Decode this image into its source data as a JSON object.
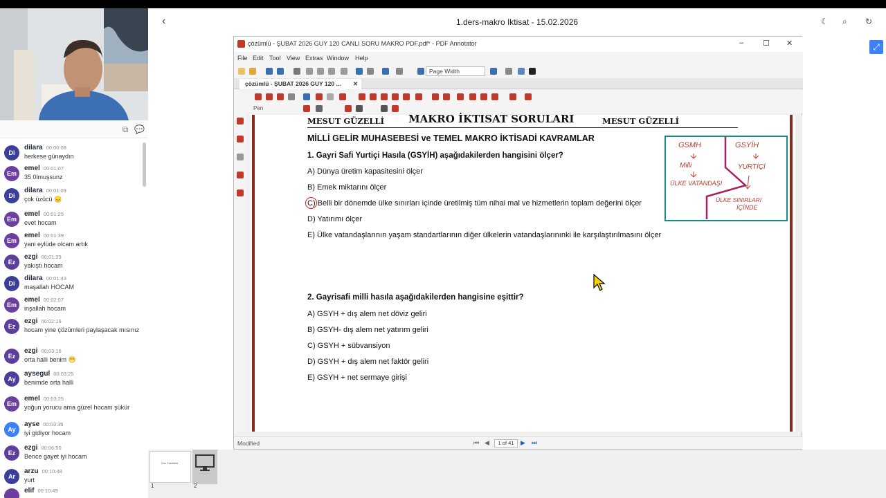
{
  "chat": {
    "messages": [
      {
        "initials": "Di",
        "name": "dilara",
        "time": "00:00:08",
        "text": "herkese günaydın",
        "color": "#3b3f9a"
      },
      {
        "initials": "Em",
        "name": "emel",
        "time": "00:01:07",
        "text": "35 0lmuşsunz",
        "color": "#6b3fa0"
      },
      {
        "initials": "Di",
        "name": "dilara",
        "time": "00:01:09",
        "text": "çok üzücü 😞",
        "color": "#3b3f9a"
      },
      {
        "initials": "Em",
        "name": "emel",
        "time": "00:01:25",
        "text": "evet hocam",
        "color": "#6b3fa0"
      },
      {
        "initials": "Em",
        "name": "emel",
        "time": "00:01:39",
        "text": "yani eylüde olcam artık",
        "color": "#6b3fa0"
      },
      {
        "initials": "Ez",
        "name": "ezgi",
        "time": "00:01:39",
        "text": "yakıştı hocam",
        "color": "#5b3f9a"
      },
      {
        "initials": "Di",
        "name": "dilara",
        "time": "00:01:43",
        "text": "maşallah HOCAM",
        "color": "#3b3f9a"
      },
      {
        "initials": "Em",
        "name": "emel",
        "time": "00:02:07",
        "text": "inşallah hocam",
        "color": "#6b3fa0"
      },
      {
        "initials": "Ez",
        "name": "ezgi",
        "time": "00:02:19",
        "text": "hocam yine çözümleri paylaşacak mısınız",
        "color": "#5b3f9a"
      },
      {
        "initials": "Ez",
        "name": "ezgi",
        "time": "00:03:16",
        "text": "orta halli benim 😁",
        "color": "#5b3f9a"
      },
      {
        "initials": "Ay",
        "name": "aysegul",
        "time": "00:03:25",
        "text": "benimde orta halli",
        "color": "#4a3f9a"
      },
      {
        "initials": "Em",
        "name": "emel",
        "time": "00:03:25",
        "text": "yoğun yorucu ama güzel hocam şükür",
        "color": "#6b3fa0"
      },
      {
        "initials": "Ay",
        "name": "ayse",
        "time": "00:03:36",
        "text": "iyi gidiyor hocam",
        "color": "#3b82f6"
      },
      {
        "initials": "Ez",
        "name": "ezgi",
        "time": "00:06:50",
        "text": "Bence gayet iyi hocam",
        "color": "#5b3f9a"
      },
      {
        "initials": "Ar",
        "name": "arzu",
        "time": "00:10:48",
        "text": "yurt",
        "color": "#3b3f9a"
      },
      {
        "initials": "",
        "name": "elif",
        "time": "00:10:49",
        "text": "",
        "color": "#6b3fa0"
      }
    ]
  },
  "header": {
    "title": "1.ders-makro Iktisat - 15.02.2026"
  },
  "app": {
    "window_title": "çözümlü - ŞUBAT 2026 GUY 120 CANLI SORU MAKRO PDF.pdf* - PDF Annotator",
    "menu": [
      "File",
      "Edit",
      "Tool",
      "View",
      "Extras",
      "Window",
      "Help"
    ],
    "zoom": "Page Width",
    "tab": "çözümlü - ŞUBAT 2026 GUY 120 ...",
    "pen_label": "Pen",
    "status": "Modified",
    "page_indicator": "1 of 41"
  },
  "doc": {
    "author_left": "MESUT GÜZELLİ",
    "heading": "MAKRO İKTISAT SORULARI",
    "author_right": "MESUT GÜZELLİ",
    "subheading": "MİLLİ GELİR MUHASEBESİ ve TEMEL MAKRO İKTİSADİ KAVRAMLAR",
    "q1": "1. Gayri Safi Yurtiçi Hasıla (GSYİH) aşağıdakilerden hangisini ölçer?",
    "q1_options": [
      "A)  Dünya üretim kapasitesini ölçer",
      "B)  Emek miktarını ölçer",
      "C)  Belli bir dönemde ülke sınırları içinde üretilmiş tüm nihai mal ve hizmetlerin toplam değerini ölçer",
      "D)  Yatırımı ölçer",
      "E)  Ülke vatandaşlarının yaşam standartlarının diğer ülkelerin vatandaşlarınınki ile karşılaştırılmasını ölçer"
    ],
    "q2": "2. Gayrisafi milli hasıla aşağıdakilerden hangisine eşittir?",
    "q2_options": [
      "A)   GSYH + dış alem net döviz geliri",
      "B) GSYH- dış alem net yatırım geliri",
      "C) GSYH + sübvansiyon",
      "D) GSYH + dış alem net faktör geliri",
      "E) GSYH + net sermaye girişi"
    ],
    "note": {
      "left_top": "GSMH",
      "right_top": "GSYİH",
      "left_mid": "Milli",
      "right_mid": "YURTİÇİ",
      "left_bottom": "ÜLKE VATANDAŞI",
      "right_bottom1": "ÜLKE SINIRLARI",
      "right_bottom2": "İÇİNDE"
    }
  },
  "slides": {
    "thumb1_label": "1",
    "thumb2_label": "2",
    "thumb1_text": "Doc Fakültesi"
  }
}
